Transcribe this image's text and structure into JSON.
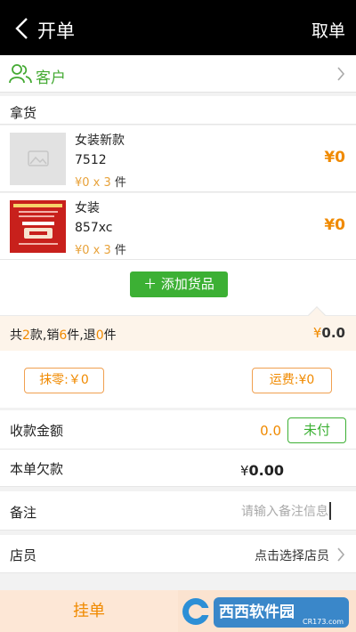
{
  "header": {
    "title": "开单",
    "right_action": "取单"
  },
  "customer": {
    "label": "客户"
  },
  "goods_section": {
    "title": "拿货"
  },
  "goods": [
    {
      "name": "女装新款",
      "code": "7512",
      "price": "¥0",
      "times": " x ",
      "qty": "3",
      "unit": " 件",
      "amount": "¥0"
    },
    {
      "name": "女装",
      "code": "857xc",
      "price": "¥0",
      "times": " x ",
      "qty": "3",
      "unit": " 件",
      "amount": "¥0"
    }
  ],
  "add_goods": {
    "label": "添加货品"
  },
  "summary": {
    "prefix": "共",
    "kinds": "2",
    "mid1": "款,销",
    "sold": "6",
    "mid2": "件,退",
    "returned": "0",
    "suffix": "件",
    "currency": "¥",
    "total": "0.0"
  },
  "fees": {
    "rounding": "抹零:￥0",
    "shipping": "运费:¥0"
  },
  "payment": {
    "label": "收款金额",
    "value": "0.0",
    "status": "未付"
  },
  "debt": {
    "label": "本单欠款",
    "currency": "¥",
    "value": "0.00"
  },
  "remark": {
    "label": "备注",
    "placeholder": "请输入备注信息"
  },
  "staff": {
    "label": "店员",
    "value": "点击选择店员"
  },
  "bottom": {
    "hang_label": "挂单"
  },
  "watermark": {
    "text": "西西软件园",
    "url": "CR173.com"
  },
  "colors": {
    "accent_green": "#3cb034",
    "accent_orange": "#f08a00",
    "header_bg": "#000000"
  }
}
